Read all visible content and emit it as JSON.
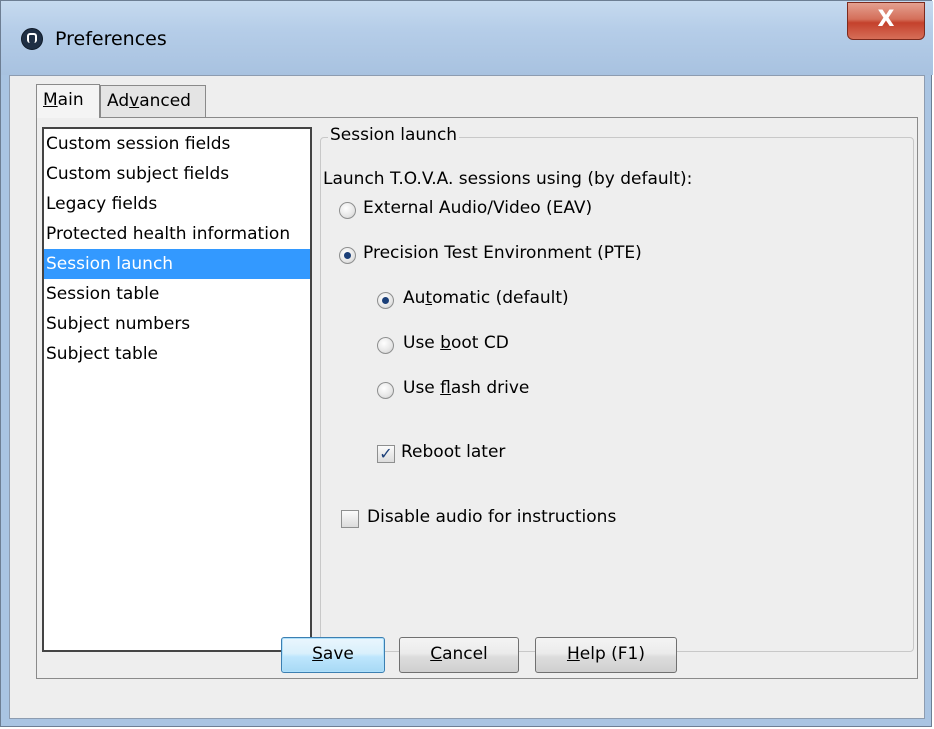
{
  "window": {
    "title": "Preferences",
    "close_label": "X"
  },
  "tabs": [
    {
      "label_pre": "",
      "label_u": "M",
      "label_post": "ain",
      "active": true
    },
    {
      "label_pre": "Ad",
      "label_u": "v",
      "label_post": "anced",
      "active": false
    }
  ],
  "sidebar": {
    "items": [
      {
        "label": "Custom session fields"
      },
      {
        "label": "Custom subject fields"
      },
      {
        "label": "Legacy fields"
      },
      {
        "label": "Protected health information"
      },
      {
        "label": "Session launch",
        "selected": true
      },
      {
        "label": "Session table"
      },
      {
        "label": "Subject numbers"
      },
      {
        "label": "Subject table"
      }
    ]
  },
  "session_launch": {
    "group_title": "Session launch",
    "prompt": "Launch T.O.V.A. sessions using (by default):",
    "eav": {
      "label": "External Audio/Video (EAV)",
      "checked": false
    },
    "pte": {
      "label": "Precision Test Environment (PTE)",
      "checked": true
    },
    "automatic": {
      "pre": "Au",
      "u": "t",
      "post": "omatic (default)",
      "checked": true
    },
    "boot_cd": {
      "pre": "Use ",
      "u": "b",
      "post": "oot CD",
      "checked": false
    },
    "flash_drive": {
      "pre": "Use ",
      "u": "f",
      "post": "lash drive",
      "checked": false
    },
    "reboot_later": {
      "label": "Reboot later",
      "checked": true,
      "mark": "✓"
    },
    "disable_audio": {
      "label": "Disable audio for instructions",
      "checked": false
    }
  },
  "buttons": {
    "save": {
      "u": "S",
      "post": "ave"
    },
    "cancel": {
      "u": "C",
      "post": "ancel"
    },
    "help": {
      "u": "H",
      "post": "elp (F1)"
    }
  }
}
